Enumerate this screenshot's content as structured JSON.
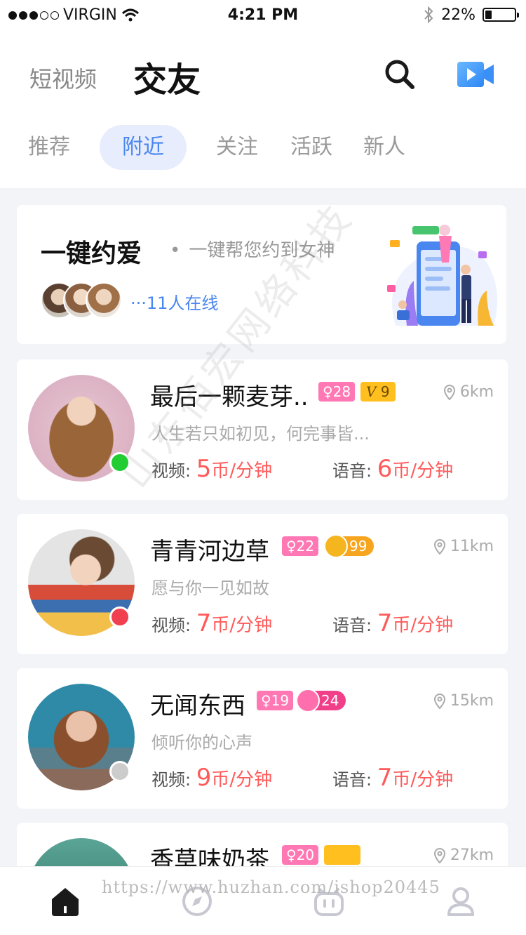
{
  "status_bar": {
    "carrier": "VIRGIN",
    "time": "4:21 PM",
    "battery": "22%",
    "battery_level": 0.22
  },
  "header": {
    "nav_secondary": "短视频",
    "nav_primary": "交友"
  },
  "tabs": [
    {
      "label": "推荐",
      "active": false
    },
    {
      "label": "附近",
      "active": true
    },
    {
      "label": "关注",
      "active": false
    },
    {
      "label": "活跃",
      "active": false
    },
    {
      "label": "新人",
      "active": false
    }
  ],
  "promo": {
    "title": "一键约爱",
    "subtitle": "一键帮您约到女神",
    "online_text": "···11人在线"
  },
  "users": [
    {
      "name": "最后一颗麦芽..",
      "gender_age": "♀28",
      "level": "9",
      "level_type": "vip",
      "distance": "6km",
      "bio": "人生若只如初见，何完事皆...",
      "video_label": "视频:",
      "video_price": "5",
      "voice_label": "语音:",
      "voice_price": "6",
      "unit": "币/分钟",
      "status": "online"
    },
    {
      "name": "青青河边草",
      "gender_age": "♀22",
      "level": "99",
      "level_type": "crown",
      "distance": "11km",
      "bio": "愿与你一见如故",
      "video_label": "视频:",
      "video_price": "7",
      "voice_label": "语音:",
      "voice_price": "7",
      "unit": "币/分钟",
      "status": "busy"
    },
    {
      "name": "无闻东西",
      "gender_age": "♀19",
      "level": "24",
      "level_type": "star",
      "distance": "15km",
      "bio": "倾听你的心声",
      "video_label": "视频:",
      "video_price": "9",
      "voice_label": "语音:",
      "voice_price": "7",
      "unit": "币/分钟",
      "status": "offline"
    },
    {
      "name": "香草味奶茶",
      "gender_age": "♀20",
      "level": "",
      "level_type": "vip",
      "distance": "27km"
    }
  ],
  "watermark": "https://www.huzhan.com/ishop20445",
  "watermark_diagonal": "山东佰宏网络科技",
  "colors": {
    "accent": "#4a86f0",
    "price": "#ff5a5a",
    "gender": "#ff78b4",
    "online": "#22cc33",
    "busy": "#f04050",
    "offline": "#cccccc"
  },
  "icons": {
    "search": "search-icon",
    "video": "video-camera-icon",
    "home": "home-icon",
    "discover": "compass-icon",
    "messages": "chat-icon",
    "profile": "user-icon"
  }
}
